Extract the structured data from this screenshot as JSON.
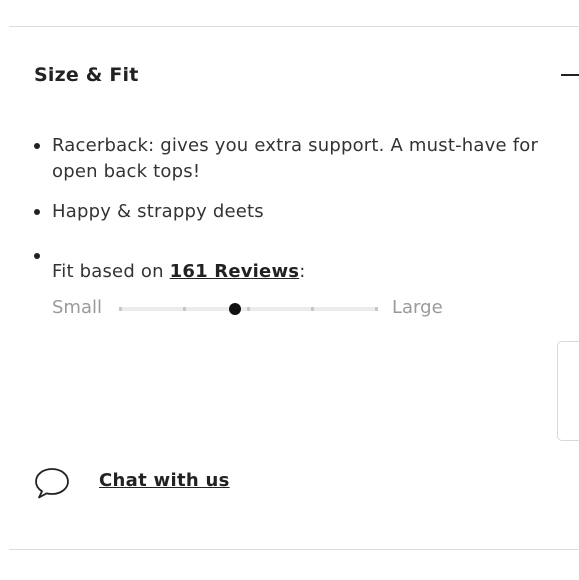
{
  "accordion": {
    "title": "Size & Fit",
    "expanded": true,
    "toggle_icon": "minus-icon"
  },
  "bullets": [
    {
      "text": "Racerback: gives you extra support. A must-have for open back tops!"
    },
    {
      "text": "Happy & strappy deets"
    }
  ],
  "fit": {
    "prefix": "Fit based on ",
    "reviews_link": "161 Reviews",
    "suffix": ":",
    "scale_low_label": "Small",
    "scale_high_label": "Large",
    "tick_count": 5,
    "value_fraction": 0.45
  },
  "chat": {
    "label": "Chat with us",
    "icon": "chat-bubble-icon"
  },
  "colors": {
    "text": "#222222",
    "muted": "#9a9a9a",
    "track": "#ececec",
    "marker": "#111111"
  }
}
